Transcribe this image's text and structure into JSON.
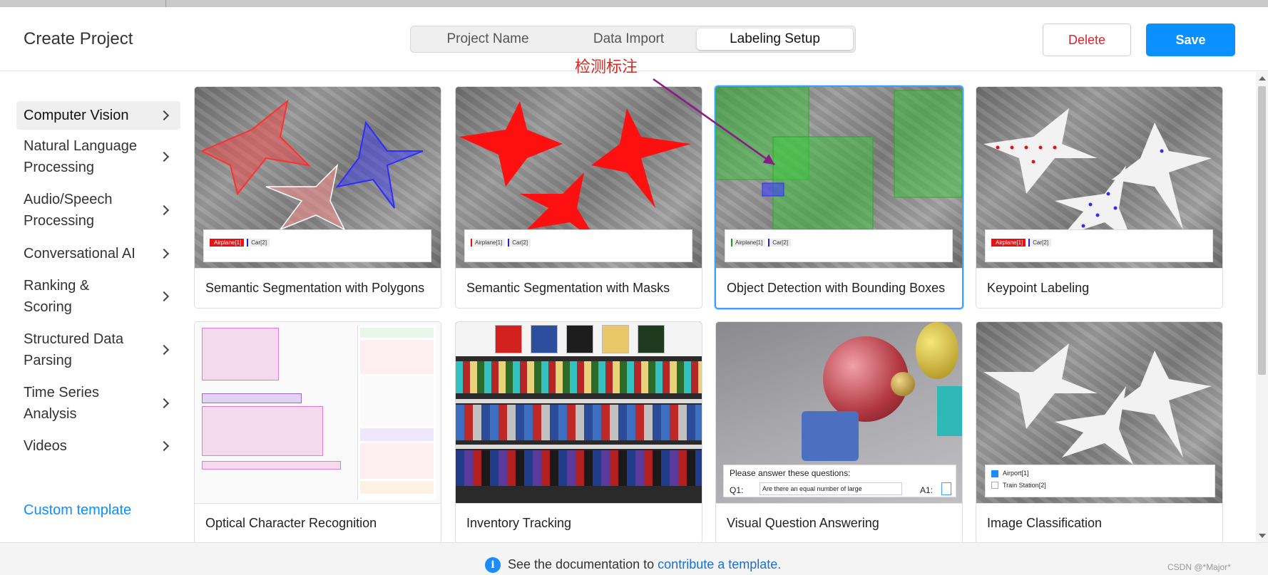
{
  "header": {
    "title": "Create Project",
    "steps": [
      "Project Name",
      "Data Import",
      "Labeling Setup"
    ],
    "active_step": "Labeling Setup",
    "delete_label": "Delete",
    "save_label": "Save"
  },
  "annotation": {
    "text": "检测标注",
    "color": "#e0251b",
    "arrow_color": "#8b1a8b"
  },
  "sidebar": {
    "items": [
      {
        "label": "Computer Vision",
        "active": true
      },
      {
        "label": "Natural Language Processing",
        "active": false
      },
      {
        "label": "Audio/Speech Processing",
        "active": false
      },
      {
        "label": "Conversational AI",
        "active": false
      },
      {
        "label": "Ranking & Scoring",
        "active": false
      },
      {
        "label": "Structured Data Parsing",
        "active": false
      },
      {
        "label": "Time Series Analysis",
        "active": false
      },
      {
        "label": "Videos",
        "active": false
      }
    ],
    "custom_template": "Custom template"
  },
  "templates": [
    {
      "label": "Semantic Segmentation with Polygons",
      "tags": [
        "Airplane[1]",
        "Car[2]"
      ]
    },
    {
      "label": "Semantic Segmentation with Masks",
      "tags": [
        "Airplane[1]",
        "Car[2]"
      ]
    },
    {
      "label": "Object Detection with Bounding Boxes",
      "tags": [
        "Airplane[1]",
        "Car[2]"
      ],
      "selected": true
    },
    {
      "label": "Keypoint Labeling",
      "tags": [
        "Airplane[1]",
        "Car[2]"
      ]
    },
    {
      "label": "Optical Character Recognition"
    },
    {
      "label": "Inventory Tracking"
    },
    {
      "label": "Visual Question Answering",
      "vqa_prompt": "Please answer these questions:",
      "q1": "Q1:",
      "a1": "A1:",
      "question": "Are there an equal number of large"
    },
    {
      "label": "Image Classification",
      "choices": [
        "Airport[1]",
        "Train Station[2]"
      ]
    }
  ],
  "footer": {
    "text": "See the documentation to",
    "link": "contribute a template.",
    "watermark": "CSDN @*Major*"
  },
  "colors": {
    "accent": "#0a90ff",
    "delete": "#d9232d",
    "selected_border": "#3aa0ff"
  }
}
